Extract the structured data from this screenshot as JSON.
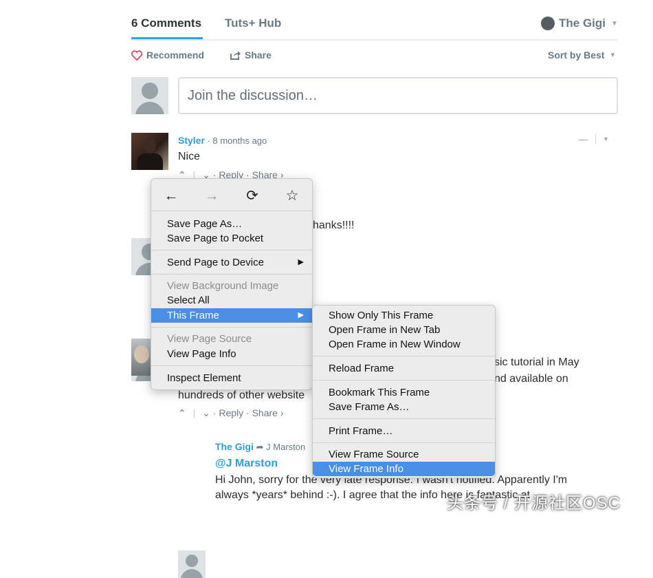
{
  "header": {
    "tabs": [
      {
        "label": "6 Comments"
      },
      {
        "label": "Tuts+ Hub"
      }
    ],
    "user": {
      "name": "The Gigi"
    },
    "recommend_label": "Recommend",
    "share_label": "Share",
    "sort_label": "Sort by Best"
  },
  "composer": {
    "placeholder": "Join the discussion…"
  },
  "comments": [
    {
      "author": "Styler",
      "time": "· 8 months ago",
      "body": "Nice",
      "actions": {
        "reply": "Reply",
        "share": "Share ›"
      }
    },
    {
      "body_visible": "hanks!!!!"
    },
    {
      "body_line1_visible": "sic tutorial in May",
      "body_line2_visible": "nd available on",
      "body_line3": "hundreds of other website",
      "actions": {
        "reply": "Reply",
        "share": "Share ›"
      }
    }
  ],
  "reply": {
    "author": "The Gigi",
    "in_reply_to": "J Marston",
    "mention": "@J Marston",
    "line1": "Hi John, sorry for the very late response. I wasn't notified. Apparently I'm",
    "line2": "always *years* behind :-). I agree that the info here is fantastic at"
  },
  "context_menu": {
    "nav": {
      "back": "←",
      "forward": "→",
      "reload": "⟳",
      "bookmark": "☆"
    },
    "items": [
      {
        "label": "Save Page As…",
        "enabled": true
      },
      {
        "label": "Save Page to Pocket",
        "enabled": true
      },
      {
        "label": "Send Page to Device",
        "enabled": true,
        "submenu": true
      },
      {
        "label": "View Background Image",
        "enabled": false
      },
      {
        "label": "Select All",
        "enabled": true
      },
      {
        "label": "This Frame",
        "enabled": true,
        "submenu": true,
        "highlighted": true
      },
      {
        "label": "View Page Source",
        "enabled": false
      },
      {
        "label": "View Page Info",
        "enabled": true
      },
      {
        "label": "Inspect Element",
        "enabled": true
      }
    ]
  },
  "frame_submenu": {
    "items": [
      {
        "label": "Show Only This Frame"
      },
      {
        "label": "Open Frame in New Tab"
      },
      {
        "label": "Open Frame in New Window"
      },
      {
        "label": "Reload Frame"
      },
      {
        "label": "Bookmark This Frame"
      },
      {
        "label": "Save Frame As…"
      },
      {
        "label": "Print Frame…"
      },
      {
        "label": "View Frame Source"
      },
      {
        "label": "View Frame Info",
        "highlighted": true
      }
    ]
  },
  "watermark": "头条号 / 开源社区OSC",
  "colors": {
    "accent": "#2e9fff",
    "link": "#2a9fd8",
    "menu_highlight": "#4a8ee8",
    "heart": "#e0455f"
  }
}
